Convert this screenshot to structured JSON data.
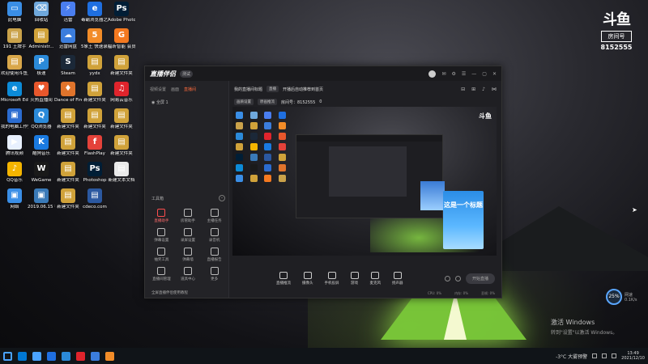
{
  "desktop": {
    "icons": [
      {
        "label": "此电脑",
        "color": "#3a8ee6",
        "glyph": "▭"
      },
      {
        "label": "回收站",
        "color": "#6fa8dc",
        "glyph": "⌫"
      },
      {
        "label": "迅雷",
        "color": "#4a7ef0",
        "glyph": "⚡"
      },
      {
        "label": "毒霸浏览器之家",
        "color": "#1f6fe0",
        "glyph": "e"
      },
      {
        "label": "Adobe Photosh...",
        "color": "#001e36",
        "glyph": "Ps"
      },
      {
        "label": "191 王牌手",
        "color": "#caa24a",
        "glyph": "▤"
      },
      {
        "label": "Administr...",
        "color": "#d0a23a",
        "glyph": "▤"
      },
      {
        "label": "迅雷网盘",
        "color": "#3b7ddd",
        "glyph": "☁"
      },
      {
        "label": "5象王 快速录屏",
        "color": "#f28c28",
        "glyph": "5"
      },
      {
        "label": "福昕智能 会员版",
        "color": "#f47920",
        "glyph": "G"
      },
      {
        "label": "欢迎使用斗鱼直播助手",
        "color": "#d9a74a",
        "glyph": "▤"
      },
      {
        "label": "极速",
        "color": "#2b8ad9",
        "glyph": "P"
      },
      {
        "label": "Steam",
        "color": "#1b2838",
        "glyph": "S"
      },
      {
        "label": "yydx",
        "color": "#d0a23a",
        "glyph": "▤"
      },
      {
        "label": "新建文件夹",
        "color": "#d0a23a",
        "glyph": "▤"
      },
      {
        "label": "Microsoft Edge",
        "color": "#0c8bd8",
        "glyph": "e"
      },
      {
        "label": "火热直播间",
        "color": "#e8572c",
        "glyph": "♥"
      },
      {
        "label": "Dance of Fire",
        "color": "#e0742c",
        "glyph": "♦"
      },
      {
        "label": "新建文件夹",
        "color": "#d0a23a",
        "glyph": "▤"
      },
      {
        "label": "网易云音乐",
        "color": "#e0242c",
        "glyph": "♫"
      },
      {
        "label": "我的电脑工作空间",
        "color": "#2b6cd0",
        "glyph": "▣"
      },
      {
        "label": "QQ浏览器",
        "color": "#2b8ad9",
        "glyph": "Q"
      },
      {
        "label": "新建文件夹",
        "color": "#d0a23a",
        "glyph": "▤"
      },
      {
        "label": "新建文件夹",
        "color": "#d0a23a",
        "glyph": "▤"
      },
      {
        "label": "新建文件夹",
        "color": "#d0a23a",
        "glyph": "▤"
      },
      {
        "label": "腾讯视频",
        "color": "#e8f0ff",
        "glyph": "▶"
      },
      {
        "label": "酷狗音乐",
        "color": "#1a7ae0",
        "glyph": "K"
      },
      {
        "label": "新建文件夹",
        "color": "#d0a23a",
        "glyph": "▤"
      },
      {
        "label": "FlashPlay",
        "color": "#e4423a",
        "glyph": "f"
      },
      {
        "label": "新建文件夹",
        "color": "#d0a23a",
        "glyph": "▤"
      },
      {
        "label": "QQ音乐",
        "color": "#f4b400",
        "glyph": "♪"
      },
      {
        "label": "WeGame",
        "color": "#1a1a1a",
        "glyph": "W"
      },
      {
        "label": "新建文件夹",
        "color": "#d0a23a",
        "glyph": "▤"
      },
      {
        "label": "Photoshop",
        "color": "#001e36",
        "glyph": "Ps"
      },
      {
        "label": "新建文本文档",
        "color": "#eaeaea",
        "glyph": "▤"
      },
      {
        "label": "网络",
        "color": "#3a8ee6",
        "glyph": "▣"
      },
      {
        "label": "2019.06.15 截图",
        "color": "#3a7ab8",
        "glyph": "▣"
      },
      {
        "label": "新建文件夹",
        "color": "#d0a23a",
        "glyph": "▤"
      },
      {
        "label": "cdeco.com",
        "color": "#2b58a0",
        "glyph": "▤"
      }
    ]
  },
  "brand": {
    "logo": "斗鱼",
    "room_label": "房间号",
    "room_number": "8152555"
  },
  "app": {
    "title": "直播伴侣",
    "version": "测试",
    "window_controls": [
      "✉",
      "⚙",
      "☰",
      "—",
      "▢",
      "✕"
    ],
    "left_tabs": [
      "视频设置",
      "画面",
      "直播间"
    ],
    "active_tab": "直播间",
    "scene_label": "全屏 1",
    "toolbox_label": "工具箱",
    "tools": [
      {
        "label": "直播助手",
        "highlight": true
      },
      {
        "label": "房管助手",
        "highlight": false
      },
      {
        "label": "主播任务",
        "highlight": false
      },
      {
        "label": "弹幕设置",
        "highlight": false
      },
      {
        "label": "录屏设置",
        "highlight": false
      },
      {
        "label": "录音机",
        "highlight": false
      },
      {
        "label": "抽奖工具",
        "highlight": false
      },
      {
        "label": "弹幕墙",
        "highlight": false
      },
      {
        "label": "直播报告",
        "highlight": false
      },
      {
        "label": "直播间管理",
        "highlight": false
      },
      {
        "label": "道具中心",
        "highlight": false
      },
      {
        "label": "更多",
        "highlight": false
      }
    ],
    "left_footer": "全屏直播伴侣使用教程",
    "info": {
      "room_title": "我的直播间标题",
      "tag1": "直播",
      "tag2": "开播后自动推荐到首页",
      "chip1": "画质设置",
      "chip2": "原画推流",
      "room_id": "房间号：8152555",
      "viewers": "0"
    },
    "preview": {
      "logo": "斗鱼",
      "card_text": "这是一个标题"
    },
    "bottom_tools": [
      "直播推流",
      "摄像头",
      "手机投屏",
      "游戏",
      "麦克风",
      "扬声器"
    ],
    "start_button": "开始直播",
    "status": [
      "CPU: 0%",
      "内存: 0%",
      "丢帧: 0%"
    ]
  },
  "perf": {
    "value": "25",
    "unit": "%",
    "caption1": "网速",
    "caption2": "0.1K/s"
  },
  "activation": {
    "title": "激活 Windows",
    "subtitle": "转到\"设置\"以激活 Windows。"
  },
  "taskbar": {
    "apps": [
      "#0078d4",
      "#4aa3ff",
      "#1f6fe0",
      "#2b8ad9",
      "#e0242c",
      "#3b7ddd",
      "#f28c28"
    ],
    "weather": "-3°C 大雾预警",
    "time": "13:49",
    "date": "2021/12/10"
  }
}
